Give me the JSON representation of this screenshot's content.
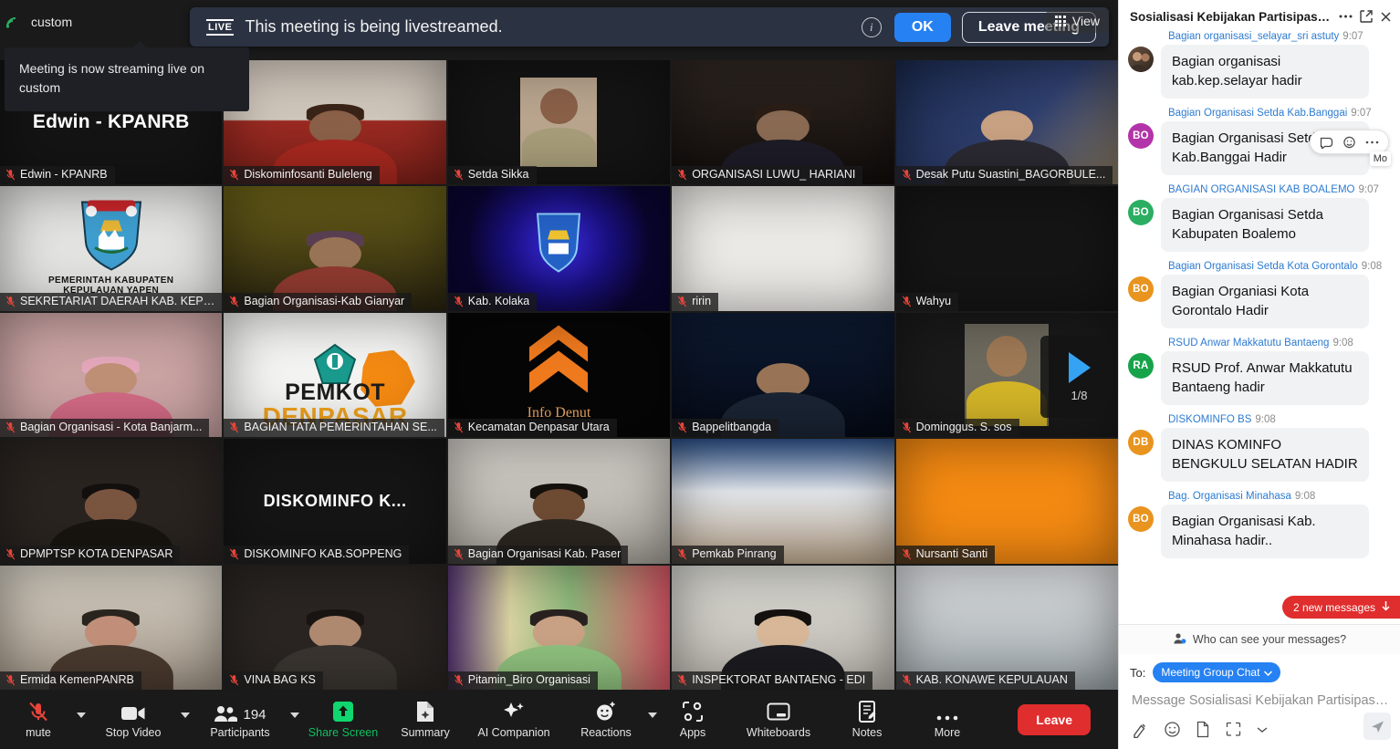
{
  "window": {
    "corner_label": "custom",
    "view_button": "View",
    "view_icon": "grid-icon",
    "signal_icon": "signal-icon"
  },
  "banner": {
    "live_badge": "LIVE",
    "text": "This meeting is being livestreamed.",
    "info_icon": "info-icon",
    "ok_label": "OK",
    "leave_meeting_label": "Leave meeting"
  },
  "tooltip": {
    "text": "Meeting is now streaming live on custom"
  },
  "pager": {
    "next_icon": "play-arrow-icon",
    "page_indicator": "1/8"
  },
  "tiles": [
    {
      "name": "Edwin - KPANRB",
      "kind": "name-only",
      "display": "Edwin - KPANRB",
      "muted": true
    },
    {
      "name": "Diskominfosanti Buleleng",
      "kind": "video",
      "muted": true
    },
    {
      "name": "Setda Sikka",
      "kind": "avatar-photo",
      "muted": true
    },
    {
      "name": "ORGANISASI LUWU_ HARIANI",
      "kind": "video",
      "muted": true
    },
    {
      "name": "Desak Putu Suastini_BAGORBULE...",
      "kind": "video",
      "muted": true
    },
    {
      "name": "SEKRETARIAT DAERAH KAB. KEPU...",
      "kind": "logo",
      "logo_line1": "PEMERINTAH KABUPATEN",
      "logo_line2": "KEPULAUAN YAPEN",
      "muted": true
    },
    {
      "name": "Bagian Organisasi-Kab Gianyar",
      "kind": "video",
      "muted": true
    },
    {
      "name": "Kab. Kolaka",
      "kind": "video",
      "muted": true
    },
    {
      "name": "ririn",
      "kind": "video",
      "muted": true
    },
    {
      "name": "Wahyu",
      "kind": "blank",
      "muted": true
    },
    {
      "name": "Bagian Organisasi - Kota Banjarm...",
      "kind": "video",
      "muted": true
    },
    {
      "name": "BAGIAN TATA PEMERINTAHAN SE...",
      "kind": "logo-text",
      "logo_line1": "PEMKOT",
      "logo_line2": "DENPASAR",
      "muted": true
    },
    {
      "name": "Kecamatan Denpasar Utara",
      "kind": "logo-text",
      "logo_line1": "Info Denut",
      "muted": true
    },
    {
      "name": "Bappelitbangda",
      "kind": "video",
      "muted": true
    },
    {
      "name": "Dominggus. S. sos",
      "kind": "video",
      "muted": true
    },
    {
      "name": "DPMPTSP KOTA DENPASAR",
      "kind": "video",
      "muted": true
    },
    {
      "name": "DISKOMINFO KAB.SOPPENG",
      "kind": "name-only",
      "display": "DISKOMINFO  K...",
      "muted": true
    },
    {
      "name": "Bagian Organisasi Kab. Paser",
      "kind": "video",
      "muted": true
    },
    {
      "name": "Pemkab Pinrang",
      "kind": "video",
      "muted": true
    },
    {
      "name": "Nursanti Santi",
      "kind": "solid-orange",
      "muted": true
    },
    {
      "name": "Ermida KemenPANRB",
      "kind": "video",
      "muted": true
    },
    {
      "name": "VINA BAG KS",
      "kind": "video",
      "muted": true
    },
    {
      "name": "Pitamin_Biro Organisasi",
      "kind": "video",
      "muted": true
    },
    {
      "name": "INSPEKTORAT BANTAENG - EDI",
      "kind": "video",
      "muted": true
    },
    {
      "name": "KAB. KONAWE KEPULAUAN",
      "kind": "video",
      "muted": true
    }
  ],
  "toolbar": {
    "items": [
      {
        "label": "mute",
        "icon": "microphone-off-icon",
        "has_caret": true,
        "badge": ""
      },
      {
        "label": "Stop Video",
        "icon": "video-camera-icon",
        "has_caret": true,
        "badge": ""
      },
      {
        "label": "Participants",
        "icon": "participants-icon",
        "has_caret": true,
        "badge": "194"
      },
      {
        "label": "Share Screen",
        "icon": "share-screen-icon",
        "has_caret": false,
        "badge": ""
      },
      {
        "label": "Summary",
        "icon": "summary-doc-icon",
        "has_caret": false,
        "badge": ""
      },
      {
        "label": "AI Companion",
        "icon": "ai-sparkle-icon",
        "has_caret": false,
        "badge": ""
      },
      {
        "label": "Reactions",
        "icon": "reactions-smiley-icon",
        "has_caret": true,
        "badge": ""
      },
      {
        "label": "Apps",
        "icon": "apps-icon",
        "has_caret": false,
        "badge": ""
      },
      {
        "label": "Whiteboards",
        "icon": "whiteboard-icon",
        "has_caret": false,
        "badge": ""
      },
      {
        "label": "Notes",
        "icon": "notes-icon",
        "has_caret": false,
        "badge": ""
      },
      {
        "label": "More",
        "icon": "more-dots-icon",
        "has_caret": false,
        "badge": ""
      }
    ],
    "leave_label": "Leave",
    "participants_count": "194"
  },
  "chat": {
    "title": "Sosialisasi Kebijakan Partisipasi ...",
    "more_icon": "more-dots-icon",
    "popout_icon": "popout-icon",
    "close_icon": "close-icon",
    "messages": [
      {
        "sender": "Bagian organisasi_selayar_sri astuty",
        "time": "9:07",
        "text": "Bagian organisasi kab.kep.selayar hadir",
        "initials": "",
        "avatar_color": "#7a6b5a",
        "avatar_kind": "photo"
      },
      {
        "sender": "Bagian Organisasi Setda Kab.Banggai",
        "time": "9:07",
        "text": "Bagian Organisasi Setda Kab.Banggai Hadir",
        "initials": "BO",
        "avatar_color": "#b334a8",
        "avatar_kind": "initials"
      },
      {
        "sender": "BAGIAN ORGANISASI KAB BOALEMO",
        "time": "9:07",
        "text": "Bagian Organisasi Setda Kabupaten Boalemo",
        "initials": "BO",
        "avatar_color": "#2bae62",
        "avatar_kind": "initials"
      },
      {
        "sender": "Bagian Organisasi Setda Kota Gorontalo",
        "time": "9:08",
        "text": "Bagian Organiasi Kota Gorontalo Hadir",
        "initials": "BO",
        "avatar_color": "#e8941f",
        "avatar_kind": "initials"
      },
      {
        "sender": "RSUD Anwar Makkatutu Bantaeng",
        "time": "9:08",
        "text": "RSUD Prof. Anwar Makkatutu Bantaeng hadir",
        "initials": "RA",
        "avatar_color": "#17a34a",
        "avatar_kind": "initials"
      },
      {
        "sender": "DISKOMINFO BS",
        "time": "9:08",
        "text": "DINAS KOMINFO BENGKULU SELATAN HADIR",
        "initials": "DB",
        "avatar_color": "#e8941f",
        "avatar_kind": "initials"
      },
      {
        "sender": "Bag. Organisasi Minahasa",
        "time": "9:08",
        "text": "Bagian Organisasi Kab. Minahasa hadir..",
        "initials": "BO",
        "avatar_color": "#e8941f",
        "avatar_kind": "initials"
      }
    ],
    "hover_actions": {
      "reply_icon": "reply-icon",
      "emoji_icon": "emoji-icon",
      "more_icon": "more-dots-icon",
      "tooltip": "Mo"
    },
    "new_messages_badge": "2 new messages",
    "new_messages_arrow": "down-arrow-icon",
    "who_can_see": "Who can see your messages?",
    "who_can_see_icon": "person-shield-icon",
    "to_label": "To:",
    "to_value": "Meeting Group Chat",
    "to_caret_icon": "chevron-down-icon",
    "input_placeholder": "Message Sosialisasi Kebijakan Partisipasi ...",
    "compose_icons": [
      "format-text-icon",
      "emoji-icon",
      "file-icon",
      "screenshot-icon",
      "chevron-down-icon"
    ],
    "send_icon": "send-icon"
  },
  "colors": {
    "accent_blue": "#2681f2",
    "leave_red": "#e02d2d",
    "share_green": "#0fbf61",
    "pager_blue": "#35a3f4",
    "orange_tile": "#f58a12"
  }
}
